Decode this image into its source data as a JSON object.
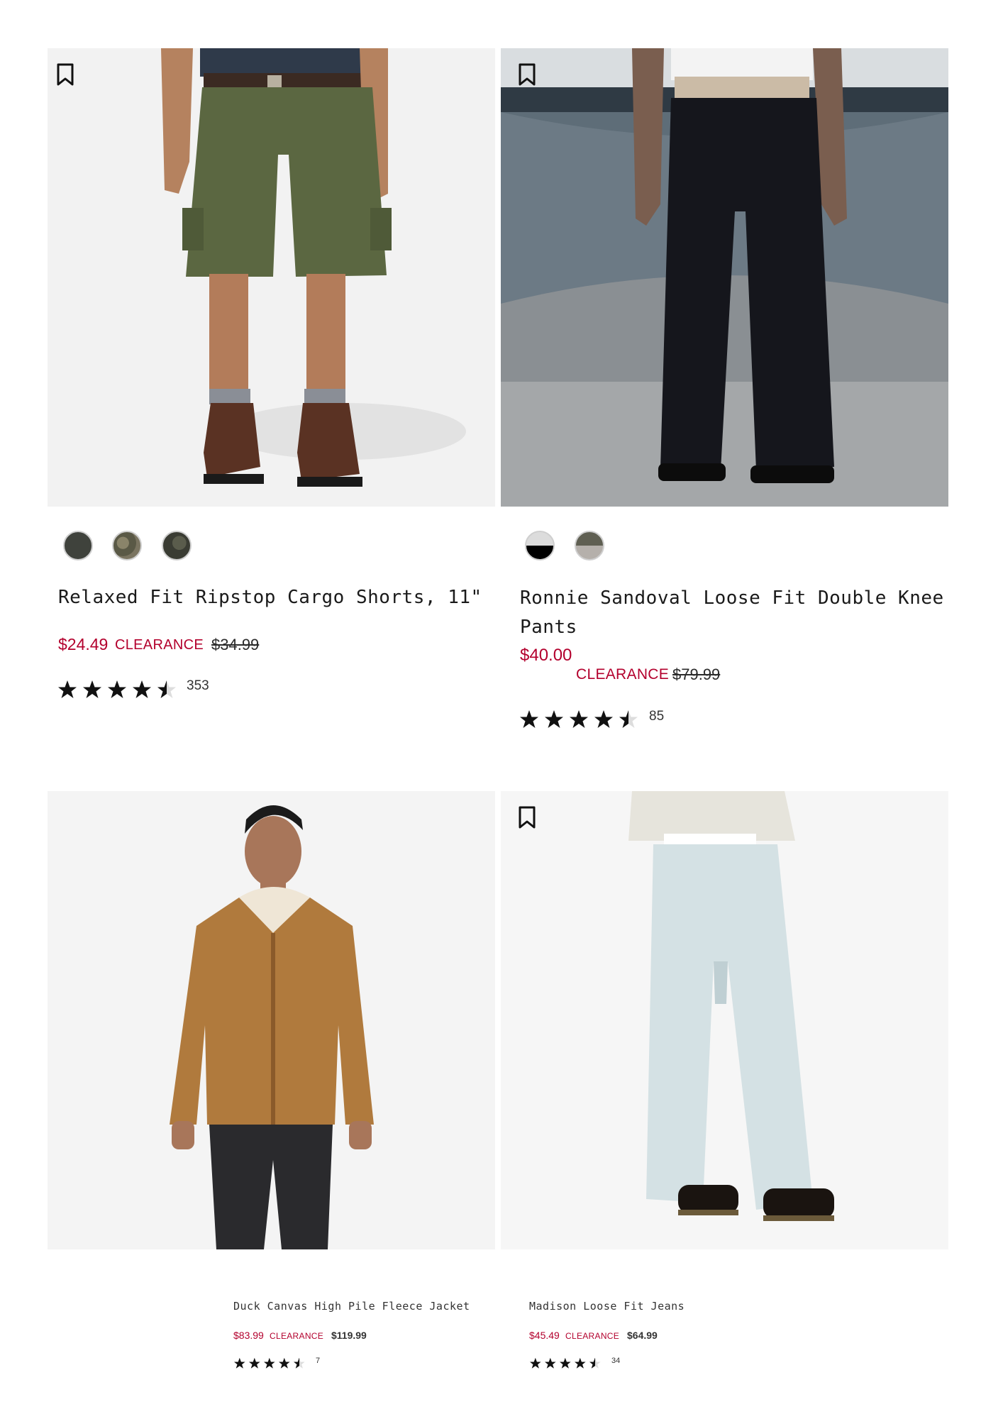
{
  "products": [
    {
      "title": "Relaxed Fit Ripstop Cargo Shorts, 11\"",
      "sale_price": "$24.49",
      "clearance_label": "CLEARANCE",
      "original_price": "$34.99",
      "rating": 4.5,
      "review_count": "353",
      "swatches": [
        "#3f423c",
        "#6e6a55",
        "#4a4c40"
      ],
      "bookmark_icon": "bookmark-icon"
    },
    {
      "title_line1": "Ronnie Sandoval Loose Fit Double Knee",
      "title_line2": "Pants",
      "sale_price": "$40.00",
      "clearance_label": "CLEARANCE",
      "original_price": "$79.99",
      "rating": 4.5,
      "review_count": "85",
      "swatches": [
        "#000000",
        "#6b6b5e"
      ],
      "bookmark_icon": "bookmark-icon"
    },
    {
      "title": "Duck Canvas High Pile Fleece Jacket",
      "sale_price": "$83.99",
      "clearance_label": "CLEARANCE",
      "original_price": "$119.99",
      "rating": 4.5,
      "review_count": "7"
    },
    {
      "title": "Madison Loose Fit Jeans",
      "sale_price": "$45.49",
      "clearance_label": "CLEARANCE",
      "original_price": "$64.99",
      "rating": 4.5,
      "review_count": "34",
      "bookmark_icon": "bookmark-icon"
    }
  ],
  "colors": {
    "sale_red": "#b3002d",
    "text": "#1a1a1a"
  }
}
